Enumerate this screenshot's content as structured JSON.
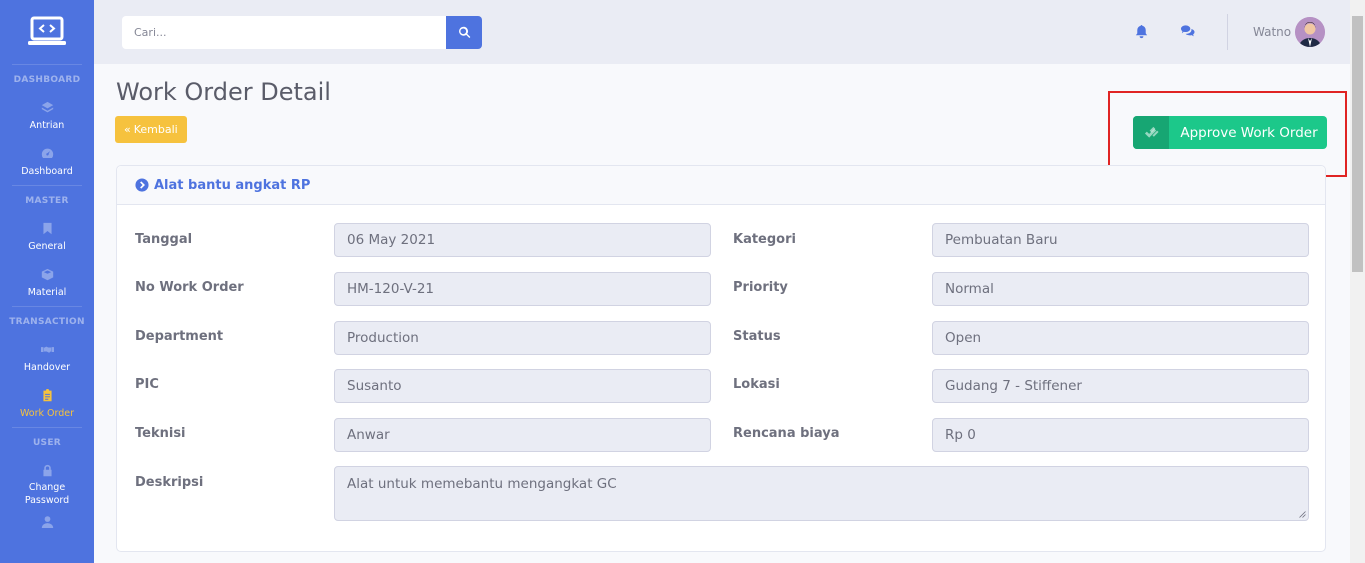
{
  "sidebar": {
    "sections": [
      {
        "heading": "DASHBOARD",
        "items": [
          {
            "label": "Antrian",
            "icon": "layers-icon"
          },
          {
            "label": "Dashboard",
            "icon": "gauge-icon"
          }
        ]
      },
      {
        "heading": "MASTER",
        "items": [
          {
            "label": "General",
            "icon": "bookmark-icon"
          },
          {
            "label": "Material",
            "icon": "cube-icon"
          }
        ]
      },
      {
        "heading": "TRANSACTION",
        "items": [
          {
            "label": "Handover",
            "icon": "handshake-icon"
          },
          {
            "label": "Work Order",
            "icon": "clipboard-icon"
          }
        ]
      },
      {
        "heading": "USER",
        "items": [
          {
            "label": "Change Password",
            "icon": "lock-icon"
          }
        ]
      }
    ]
  },
  "topbar": {
    "search_placeholder": "Cari...",
    "username": "Watno"
  },
  "page": {
    "title": "Work Order Detail",
    "back_label": "Kembali",
    "approve_label": "Approve Work Order"
  },
  "card": {
    "title": "Alat bantu angkat RP",
    "fields": {
      "tanggal": {
        "label": "Tanggal",
        "value": "06 May 2021"
      },
      "no_wo": {
        "label": "No Work Order",
        "value": "HM-120-V-21"
      },
      "department": {
        "label": "Department",
        "value": "Production"
      },
      "pic": {
        "label": "PIC",
        "value": "Susanto"
      },
      "teknisi": {
        "label": "Teknisi",
        "value": "Anwar"
      },
      "kategori": {
        "label": "Kategori",
        "value": "Pembuatan Baru"
      },
      "priority": {
        "label": "Priority",
        "value": "Normal"
      },
      "status": {
        "label": "Status",
        "value": "Open"
      },
      "lokasi": {
        "label": "Lokasi",
        "value": "Gudang 7 - Stiffener"
      },
      "biaya": {
        "label": "Rencana biaya",
        "value": "Rp 0"
      },
      "deskripsi": {
        "label": "Deskripsi",
        "value": "Alat untuk memebantu mengangkat GC"
      }
    }
  },
  "colors": {
    "primary": "#4e73df",
    "success": "#1cc88a",
    "warning": "#f6c23e",
    "highlight": "#e02424"
  }
}
